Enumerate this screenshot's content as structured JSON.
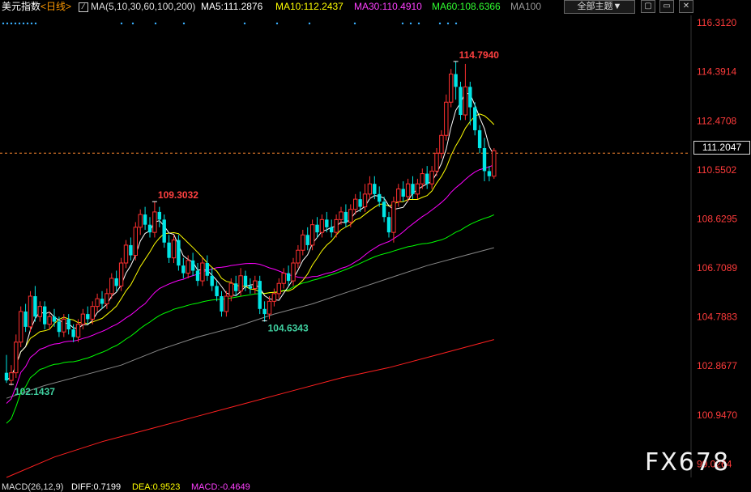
{
  "header": {
    "instrument": "美元指数",
    "period": "<日线>",
    "ma_params": "MA(5,10,30,60,100,200)",
    "ma5": "MA5:111.2876",
    "ma10": "MA10:112.2437",
    "ma30": "MA30:110.4910",
    "ma60": "MA60:108.6366",
    "ma100": "MA100",
    "theme_button": "全部主题▼",
    "colors": {
      "ma5": "#ffffff",
      "ma10": "#ffff00",
      "ma30": "#ff00ff",
      "ma60": "#00ff00",
      "ma100": "#888888",
      "ma200": "#ff2020"
    }
  },
  "window_buttons": [
    "▢",
    "▭",
    "✕"
  ],
  "footer": {
    "macd": "MACD(26,12,9)",
    "diff": "DIFF:0.7199",
    "dea": "DEA:0.9523",
    "macd_val": "MACD:-0.4649"
  },
  "watermark": "FX678",
  "current_price": "111.2047",
  "chart_data": {
    "type": "candlestick",
    "y_axis": {
      "ylim": [
        98.5,
        116.6
      ],
      "ticks": [
        "116.3120",
        "114.3914",
        "112.4708",
        "110.5502",
        "108.6295",
        "106.7089",
        "104.7883",
        "102.8677",
        "100.9470",
        "99.0264"
      ]
    },
    "current_price": 111.2047,
    "annotations": [
      {
        "label": "114.7940",
        "index": 94,
        "value": 114.794,
        "kind": "high"
      },
      {
        "label": "109.3032",
        "index": 31,
        "value": 109.3032,
        "kind": "high"
      },
      {
        "label": "104.6343",
        "index": 54,
        "value": 104.6343,
        "kind": "low"
      },
      {
        "label": "102.1437",
        "index": 1,
        "value": 102.1437,
        "kind": "low"
      }
    ],
    "candles": [
      [
        102.6,
        102.3,
        103.3,
        102.2
      ],
      [
        102.3,
        102.6,
        102.9,
        102.1
      ],
      [
        102.6,
        103.8,
        104.1,
        102.4
      ],
      [
        103.8,
        105.0,
        105.2,
        103.6
      ],
      [
        105.0,
        104.4,
        105.3,
        104.2
      ],
      [
        104.4,
        105.6,
        105.8,
        104.2
      ],
      [
        105.6,
        104.8,
        106.0,
        104.6
      ],
      [
        104.8,
        105.2,
        105.4,
        104.6
      ],
      [
        105.2,
        104.5,
        105.4,
        104.3
      ],
      [
        104.5,
        104.8,
        105.0,
        104.3
      ],
      [
        104.8,
        104.6,
        105.1,
        104.4
      ],
      [
        104.6,
        104.2,
        104.8,
        104.0
      ],
      [
        104.2,
        104.7,
        104.9,
        104.0
      ],
      [
        104.7,
        104.3,
        104.9,
        104.1
      ],
      [
        104.3,
        104.0,
        104.5,
        103.8
      ],
      [
        104.0,
        104.5,
        104.7,
        103.8
      ],
      [
        104.5,
        104.9,
        105.1,
        104.3
      ],
      [
        104.9,
        104.7,
        105.2,
        104.5
      ],
      [
        104.7,
        105.2,
        105.4,
        104.5
      ],
      [
        105.2,
        105.5,
        105.7,
        105.0
      ],
      [
        105.5,
        105.3,
        105.8,
        105.1
      ],
      [
        105.3,
        105.7,
        105.9,
        105.1
      ],
      [
        105.7,
        106.3,
        106.5,
        105.5
      ],
      [
        106.3,
        106.0,
        106.6,
        105.8
      ],
      [
        106.0,
        106.9,
        107.1,
        105.8
      ],
      [
        106.9,
        107.6,
        107.8,
        106.7
      ],
      [
        107.6,
        107.2,
        107.9,
        107.0
      ],
      [
        107.2,
        108.3,
        108.5,
        107.0
      ],
      [
        108.3,
        108.8,
        109.0,
        108.0
      ],
      [
        108.8,
        108.4,
        109.1,
        108.2
      ],
      [
        108.4,
        108.1,
        108.7,
        107.9
      ],
      [
        108.1,
        108.9,
        109.3,
        107.9
      ],
      [
        108.9,
        108.6,
        109.1,
        108.3
      ],
      [
        108.6,
        107.7,
        108.8,
        107.5
      ],
      [
        107.7,
        107.1,
        108.0,
        106.9
      ],
      [
        107.1,
        107.8,
        108.0,
        106.9
      ],
      [
        107.8,
        106.8,
        108.0,
        106.6
      ],
      [
        106.8,
        106.5,
        107.1,
        106.3
      ],
      [
        106.5,
        107.0,
        107.2,
        106.3
      ],
      [
        107.0,
        106.6,
        107.3,
        106.4
      ],
      [
        106.6,
        106.2,
        106.9,
        106.0
      ],
      [
        106.2,
        106.9,
        107.1,
        106.0
      ],
      [
        106.9,
        106.4,
        107.2,
        106.2
      ],
      [
        106.4,
        106.0,
        106.7,
        105.8
      ],
      [
        106.0,
        105.6,
        106.2,
        105.4
      ],
      [
        105.6,
        105.0,
        105.8,
        104.8
      ],
      [
        105.0,
        105.6,
        105.8,
        104.8
      ],
      [
        105.6,
        106.1,
        106.3,
        105.4
      ],
      [
        106.1,
        105.8,
        106.4,
        105.6
      ],
      [
        105.8,
        106.4,
        106.7,
        105.6
      ],
      [
        106.4,
        106.0,
        106.6,
        105.8
      ],
      [
        106.0,
        105.9,
        106.3,
        105.7
      ],
      [
        105.9,
        106.2,
        106.4,
        105.7
      ],
      [
        106.2,
        105.1,
        106.4,
        104.9
      ],
      [
        105.1,
        104.9,
        105.4,
        104.6
      ],
      [
        104.9,
        105.4,
        105.6,
        104.7
      ],
      [
        105.4,
        105.7,
        105.9,
        105.2
      ],
      [
        105.7,
        106.1,
        106.3,
        105.5
      ],
      [
        106.1,
        106.5,
        106.7,
        105.9
      ],
      [
        106.5,
        106.2,
        106.8,
        106.0
      ],
      [
        106.2,
        106.9,
        107.1,
        106.0
      ],
      [
        106.9,
        107.4,
        107.6,
        106.7
      ],
      [
        107.4,
        108.0,
        108.2,
        107.2
      ],
      [
        108.0,
        107.6,
        108.3,
        107.4
      ],
      [
        107.6,
        108.4,
        108.6,
        107.4
      ],
      [
        108.4,
        108.1,
        108.7,
        107.9
      ],
      [
        108.1,
        108.6,
        108.8,
        107.9
      ],
      [
        108.6,
        108.3,
        108.9,
        108.1
      ],
      [
        108.3,
        108.1,
        108.6,
        107.9
      ],
      [
        108.1,
        108.6,
        108.8,
        107.9
      ],
      [
        108.6,
        108.9,
        109.1,
        108.4
      ],
      [
        108.9,
        108.5,
        109.2,
        108.3
      ],
      [
        108.5,
        109.0,
        109.2,
        108.3
      ],
      [
        109.0,
        109.4,
        109.6,
        108.8
      ],
      [
        109.4,
        109.1,
        109.7,
        108.9
      ],
      [
        109.1,
        109.6,
        110.0,
        108.9
      ],
      [
        109.6,
        110.0,
        110.3,
        109.4
      ],
      [
        110.0,
        109.6,
        110.3,
        109.4
      ],
      [
        109.6,
        109.3,
        109.9,
        109.1
      ],
      [
        109.3,
        108.7,
        109.5,
        108.5
      ],
      [
        108.7,
        108.1,
        108.9,
        107.9
      ],
      [
        108.1,
        109.3,
        109.5,
        107.7
      ],
      [
        109.3,
        109.8,
        110.0,
        109.1
      ],
      [
        109.8,
        109.5,
        110.1,
        109.3
      ],
      [
        109.5,
        110.0,
        110.2,
        109.3
      ],
      [
        110.0,
        109.6,
        110.3,
        109.4
      ],
      [
        109.6,
        110.0,
        110.2,
        109.4
      ],
      [
        110.0,
        110.4,
        110.6,
        109.8
      ],
      [
        110.4,
        110.0,
        110.7,
        109.8
      ],
      [
        110.0,
        110.5,
        110.7,
        109.8
      ],
      [
        110.5,
        111.2,
        111.4,
        110.3
      ],
      [
        111.2,
        111.9,
        112.1,
        111.0
      ],
      [
        111.9,
        113.2,
        113.5,
        111.7
      ],
      [
        113.2,
        114.3,
        114.5,
        113.0
      ],
      [
        114.3,
        113.8,
        114.8,
        113.3
      ],
      [
        113.8,
        112.7,
        114.0,
        112.5
      ],
      [
        112.7,
        113.8,
        114.7,
        112.5
      ],
      [
        113.8,
        113.0,
        114.0,
        112.3
      ],
      [
        113.0,
        112.1,
        113.2,
        111.9
      ],
      [
        112.1,
        111.4,
        112.3,
        111.2
      ],
      [
        111.4,
        110.5,
        111.8,
        110.1
      ],
      [
        110.5,
        110.3,
        110.7,
        110.1
      ],
      [
        110.3,
        111.3,
        111.4,
        110.2
      ]
    ],
    "moving_averages": {
      "ma100": [
        [
          0,
          101.6
        ],
        [
          8,
          102.1
        ],
        [
          16,
          102.5
        ],
        [
          24,
          102.9
        ],
        [
          32,
          103.5
        ],
        [
          40,
          104.0
        ],
        [
          48,
          104.4
        ],
        [
          56,
          104.9
        ],
        [
          64,
          105.3
        ],
        [
          72,
          105.8
        ],
        [
          80,
          106.3
        ],
        [
          88,
          106.8
        ],
        [
          96,
          107.2
        ],
        [
          102,
          107.5
        ]
      ],
      "ma200": [
        [
          0,
          98.5
        ],
        [
          10,
          99.3
        ],
        [
          20,
          99.9
        ],
        [
          30,
          100.4
        ],
        [
          40,
          100.9
        ],
        [
          50,
          101.4
        ],
        [
          60,
          101.9
        ],
        [
          70,
          102.4
        ],
        [
          80,
          102.8
        ],
        [
          90,
          103.3
        ],
        [
          96,
          103.6
        ],
        [
          102,
          103.9
        ]
      ]
    }
  }
}
